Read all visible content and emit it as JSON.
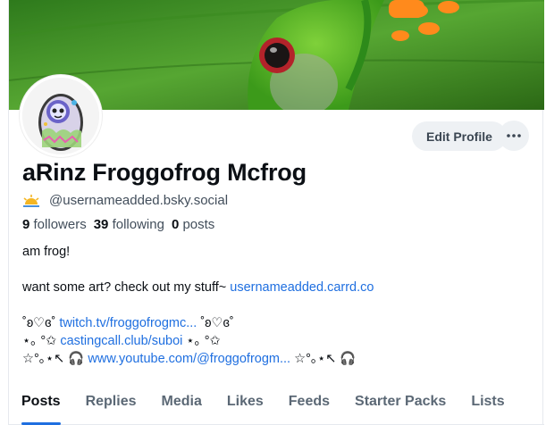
{
  "profile": {
    "display_name": "aRinz Froggofrog Mcfrog",
    "handle": "@usernameadded.bsky.social",
    "handle_icon": "sunrise-icon"
  },
  "actions": {
    "edit_label": "Edit Profile",
    "more_label": "···"
  },
  "stats": {
    "followers_count": "9",
    "followers_label": "followers",
    "following_count": "39",
    "following_label": "following",
    "posts_count": "0",
    "posts_label": "posts"
  },
  "bio": {
    "line1": "am frog!",
    "line2_text": "want some art? check out my stuff~ ",
    "line2_link": "usernameadded.carrd.co",
    "line3_prefix": "˚ʚ♡ɞ˚ ",
    "line3_link": "twitch.tv/froggofrogmc...",
    "line3_suffix": " ˚ʚ♡ɞ˚",
    "line4_prefix": "⋆｡ °✩ ",
    "line4_link": "castingcall.club/suboi",
    "line4_suffix": " ⋆｡ °✩",
    "line5_prefix": "☆°｡⋆↖ 🎧 ",
    "line5_link": "www.youtube.com/@froggofrogm...",
    "line5_suffix": "  ☆°｡⋆↖ 🎧"
  },
  "tabs": [
    {
      "label": "Posts",
      "active": true
    },
    {
      "label": "Replies"
    },
    {
      "label": "Media"
    },
    {
      "label": "Likes"
    },
    {
      "label": "Feeds"
    },
    {
      "label": "Starter Packs"
    },
    {
      "label": "Lists"
    }
  ],
  "colors": {
    "link": "#1f6fe0",
    "active_tab_underline": "#1f6fe0",
    "button_bg": "#eef1f4"
  }
}
